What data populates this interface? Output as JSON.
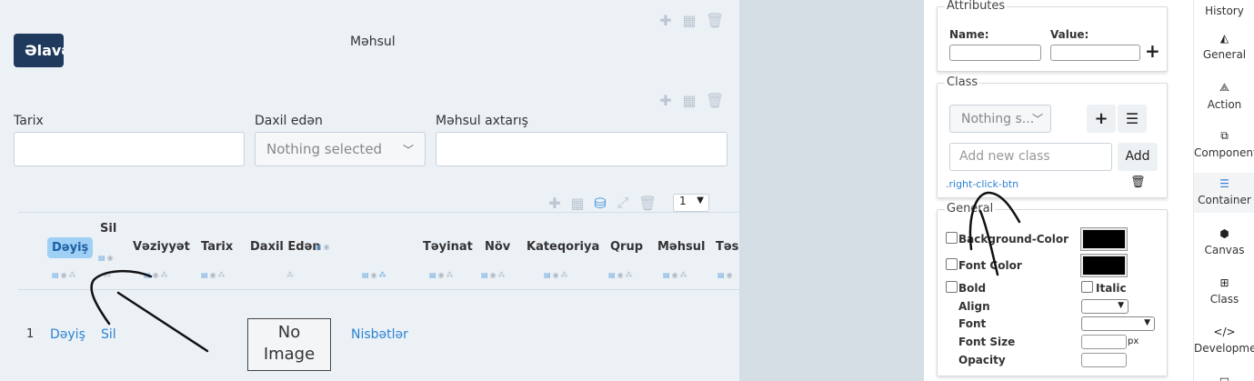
{
  "canvas": {
    "add_button_label": "Əlavə",
    "title": "Məhsul",
    "toolbar_icons": [
      "plus-icon",
      "table-icon",
      "trash-icon"
    ],
    "filters": {
      "date_label": "Tarix",
      "entered_by_label": "Daxil edən",
      "entered_by_value": "Nothing selected",
      "product_search_label": "Məhsul axtarış"
    },
    "grid_toolbar_icons": [
      "plus-icon",
      "table-icon",
      "inbox-icon",
      "expand-icon",
      "trash-icon"
    ],
    "page_size": "1",
    "columns": [
      "Dəyiş",
      "Sil",
      "Vəziyyət",
      "Tarix",
      "Daxil Edən",
      "Təyinat",
      "Növ",
      "Kateqoriya",
      "Qrup",
      "Məhsul",
      "Təs"
    ],
    "row": {
      "number": "1",
      "edit_link": "Dəyiş",
      "delete_link": "Sil",
      "image_placeholder_line1": "No",
      "image_placeholder_line2": "Image",
      "relations_link": "Nisbətlər"
    }
  },
  "props": {
    "attributes": {
      "title": "Attributes",
      "name_label": "Name:",
      "value_label": "Value:",
      "name_value": "",
      "value_value": ""
    },
    "class": {
      "title": "Class",
      "select_value": "Nothing s...",
      "new_class_placeholder": "Add new class",
      "add_label": "Add",
      "class_item": ".right-click-btn"
    },
    "general": {
      "title": "General",
      "background_color_label": "Background-Color",
      "font_color_label": "Font Color",
      "bold_label": "Bold",
      "italic_label": "Italic",
      "align_label": "Align",
      "font_label": "Font",
      "font_size_label": "Font Size",
      "font_size_unit": "px",
      "opacity_label": "Opacity",
      "background_color": "#000000",
      "font_color": "#000000"
    }
  },
  "sidebar": {
    "items": [
      {
        "label": "History",
        "icon": "history-icon"
      },
      {
        "label": "General",
        "icon": "general-icon"
      },
      {
        "label": "Action",
        "icon": "action-icon"
      },
      {
        "label": "Components",
        "icon": "components-icon"
      },
      {
        "label": "Container",
        "icon": "container-icon"
      },
      {
        "label": "Canvas",
        "icon": "canvas-icon"
      },
      {
        "label": "Class",
        "icon": "class-icon"
      },
      {
        "label": "Development",
        "icon": "development-icon"
      }
    ]
  },
  "colors": {
    "accent": "#2c83d2",
    "primary_button": "#1f3a5c",
    "canvas_bg": "#ecf1f6"
  }
}
